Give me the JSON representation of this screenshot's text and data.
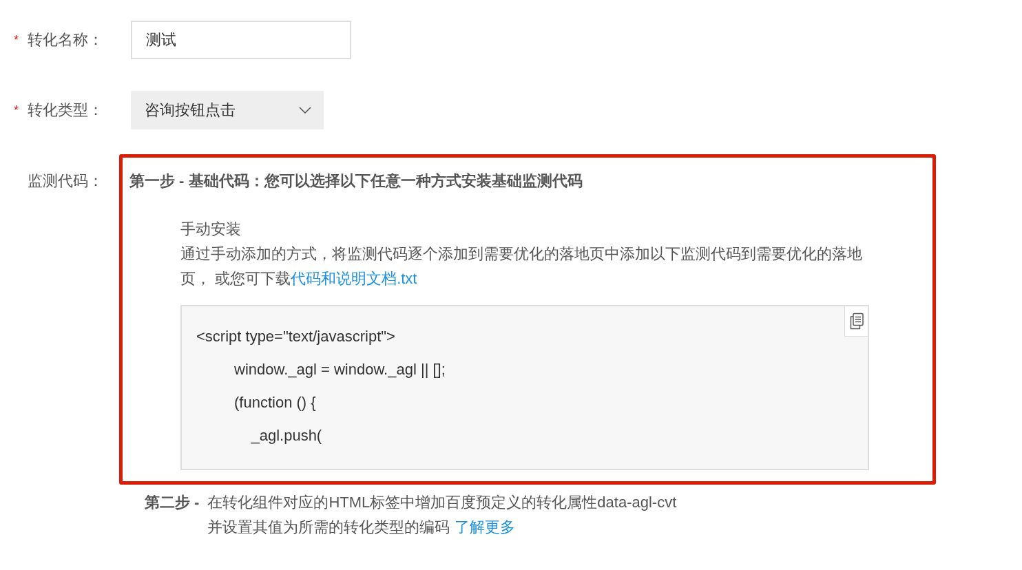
{
  "fields": [
    {
      "kind": "text",
      "marker": "*",
      "label": "转化名称：",
      "required": true,
      "value": "测试"
    },
    {
      "kind": "select",
      "marker": "*",
      "label": "转化类型：",
      "required": true,
      "value": "咨询按钮点击"
    }
  ],
  "monitor": {
    "label": "监测代码：",
    "highlighted": true,
    "step1": {
      "title": "第一步 - 基础代码：您可以选择以下任意一种方式安装基础监测代码",
      "method": "手动安装",
      "description": "通过手动添加的方式，将监测代码逐个添加到需要优化的落地页中添加以下监测代码到需要优化的落地页， 或您可下载",
      "link": "代码和说明文档.txt",
      "code_lines": [
        "<script type=\"text/javascript\">",
        "         window._agl = window._agl || [];",
        "         (function () {",
        "             _agl.push("
      ]
    },
    "step2": {
      "label": "第二步 -",
      "text": "在转化组件对应的HTML标签中增加百度预定义的转化属性data-agl-cvt\n并设置其值为所需的转化类型的编码",
      "link": "了解更多"
    }
  }
}
